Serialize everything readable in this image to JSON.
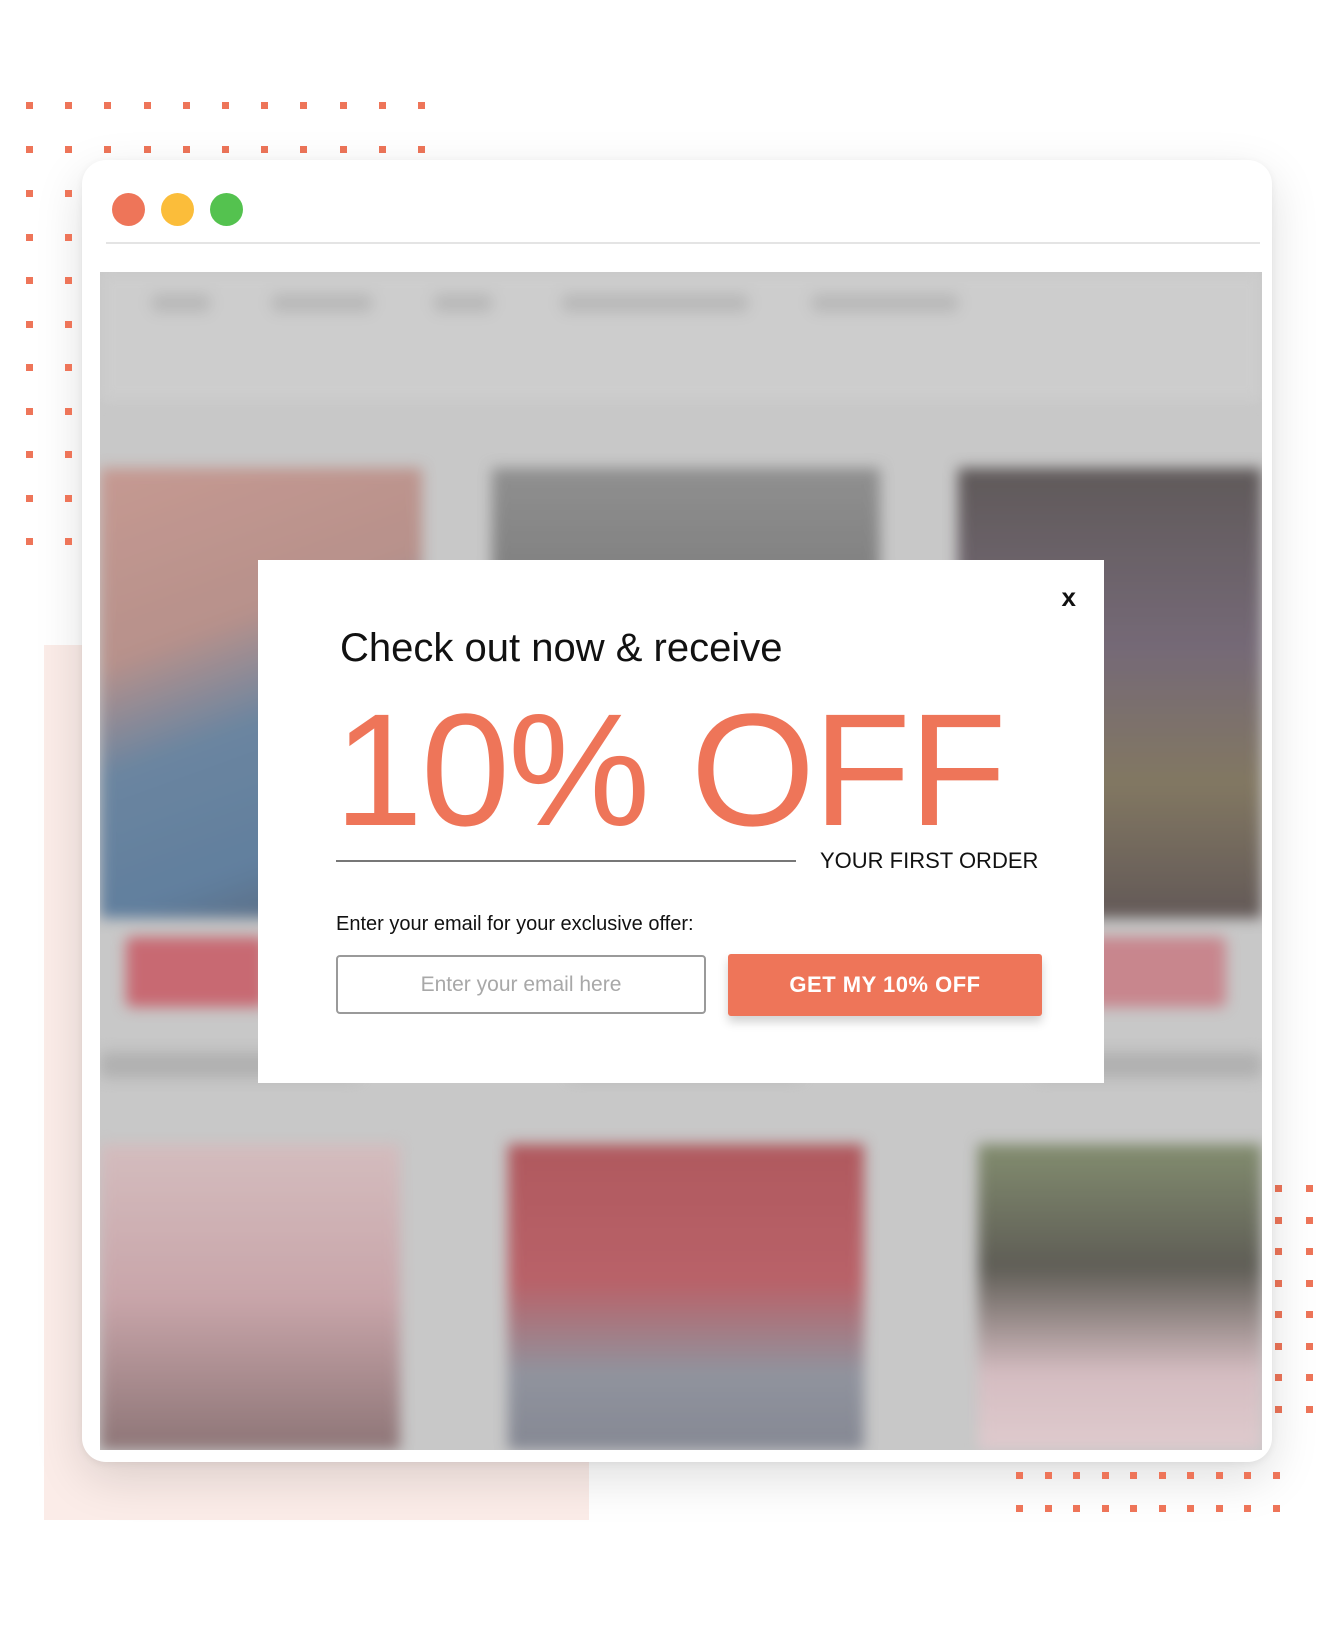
{
  "theme": {
    "accent": "#ee7559",
    "dot_color": "#ee7559",
    "pink_background": "#fbece8",
    "traffic_lights": [
      "#ee7559",
      "#fbbd3a",
      "#54c24f"
    ]
  },
  "window": {
    "controls": [
      "close-dot",
      "minimize-dot",
      "maximize-dot"
    ]
  },
  "popup": {
    "close_label": "x",
    "headline": "Check out now & receive",
    "offer": "10% OFF",
    "subline": "YOUR FIRST ORDER",
    "email_label": "Enter your email for your exclusive offer:",
    "email_placeholder": "Enter your email here",
    "email_value": "",
    "cta_label": "GET MY 10% OFF"
  }
}
